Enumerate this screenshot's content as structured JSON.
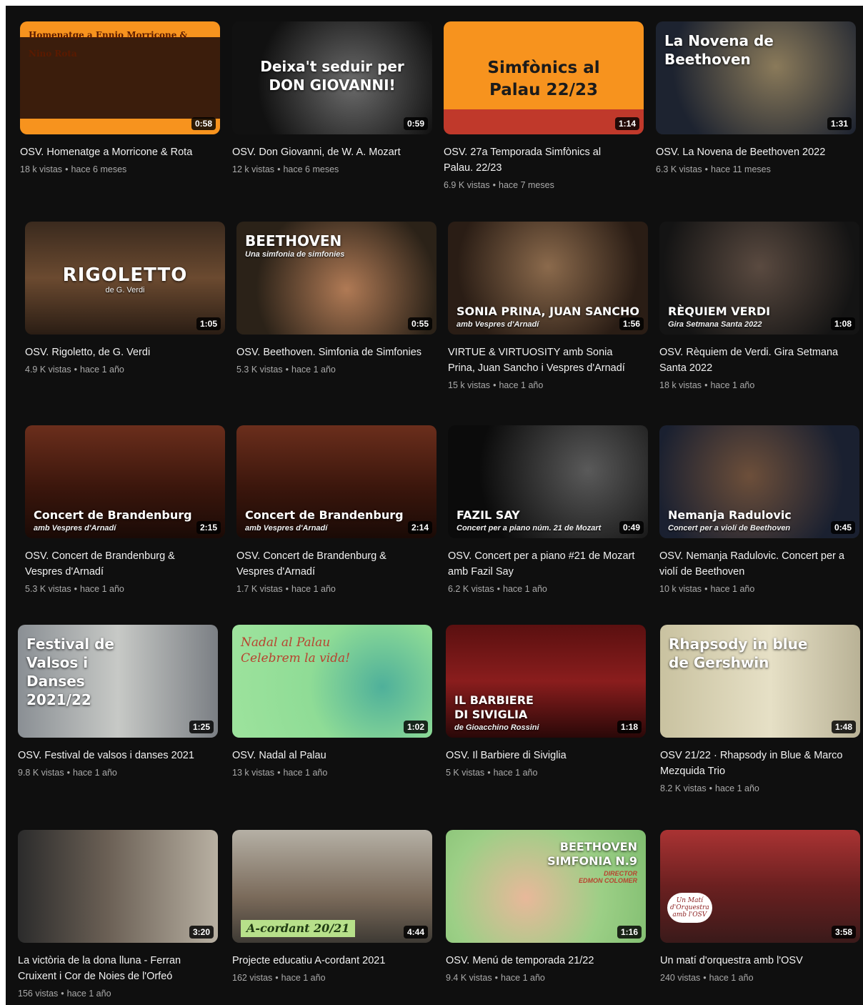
{
  "colors": {
    "background": "#0f0f0f",
    "title": "#f1f1f1",
    "meta": "#aaaaaa"
  },
  "rows": [
    [
      {
        "title": "OSV. Homenatge a Morricone & Rota",
        "views": "18 k vistas",
        "age": "hace 6 meses",
        "duration": "0:58",
        "thumb_text": "Homenatge a Ennio Morricone & Nino Rota",
        "thumb_bg": "linear-gradient(180deg,#f7931e 0 14%,#3b1d0c 14% 86%,#f7931e 86%)"
      },
      {
        "title": "OSV. Don Giovanni, de W. A. Mozart",
        "views": "12 k vistas",
        "age": "hace 6 meses",
        "duration": "0:59",
        "thumb_text": "Deixa't seduir per\nDON GIOVANNI!",
        "thumb_bg": "radial-gradient(circle at 60% 55%,#6b6b6b,#111 70%)"
      },
      {
        "title": "OSV. 27a Temporada Simfònics al Palau. 22/23",
        "views": "6.9 K vistas",
        "age": "hace 7 meses",
        "duration": "1:14",
        "thumb_text": "Simfònics al\nPalau 22/23",
        "thumb_bg": "linear-gradient(180deg,#f7931e 0 78%,#c0392b 78%)"
      },
      {
        "title": "OSV. La Novena de Beethoven 2022",
        "views": "6.3 K vistas",
        "age": "hace 11 meses",
        "duration": "1:31",
        "thumb_text": "La Novena de\nBeethoven",
        "thumb_bg": "radial-gradient(circle at 60% 40%,#8a7a5a,#1d2330 75%)"
      }
    ],
    [
      {
        "title": "OSV. Rigoletto, de G. Verdi",
        "views": "4.9 K vistas",
        "age": "hace 1 año",
        "duration": "1:05",
        "thumb_text": "RIGOLETTO",
        "thumb_sub": "de G. Verdi",
        "thumb_bg": "linear-gradient(180deg,#3a2a1e,#6b4a30 50%,#2a1d14)"
      },
      {
        "title": "OSV. Beethoven. Simfonia de Simfonies",
        "views": "5.3 K vistas",
        "age": "hace 1 año",
        "duration": "0:55",
        "thumb_text": "BEETHOVEN",
        "thumb_sub": "Una simfonia de simfonies",
        "thumb_bg": "radial-gradient(circle at 55% 60%,#b07a55,#2b2218 70%)"
      },
      {
        "title": "VIRTUE & VIRTUOSITY amb Sonia Prina, Juan Sancho i Vespres d'Arnadí",
        "views": "15 k vistas",
        "age": "hace 1 año",
        "duration": "1:56",
        "thumb_text": "SONIA PRINA, JUAN SANCHO",
        "thumb_sub": "amb Vespres d'Arnadí",
        "thumb_bg": "radial-gradient(circle at 50% 40%,#8b6a4c,#2a1d15 75%)"
      },
      {
        "title": "OSV. Rèquiem de Verdi. Gira Setmana Santa 2022",
        "views": "18 k vistas",
        "age": "hace 1 año",
        "duration": "1:08",
        "thumb_text": "RÈQUIEM VERDI",
        "thumb_sub": "Gira Setmana Santa 2022",
        "thumb_bg": "radial-gradient(circle at 50% 40%,#5a4a40,#141414 80%)"
      }
    ],
    [
      {
        "title": "OSV. Concert de Brandenburg & Vespres d'Arnadí",
        "views": "5.3 K vistas",
        "age": "hace 1 año",
        "duration": "2:15",
        "thumb_text": "Concert de Brandenburg",
        "thumb_sub": "amb Vespres d'Arnadí",
        "thumb_bg": "linear-gradient(180deg,#6b2e1c,#3b160c 55%,#1a0a06)"
      },
      {
        "title": "OSV. Concert de Brandenburg & Vespres d'Arnadí",
        "views": "1.7 K vistas",
        "age": "hace 1 año",
        "duration": "2:14",
        "thumb_text": "Concert de Brandenburg",
        "thumb_sub": "amb Vespres d'Arnadí",
        "thumb_bg": "linear-gradient(180deg,#6b2e1c,#3b160c 55%,#1a0a06)"
      },
      {
        "title": "OSV. Concert per a piano #21 de Mozart amb Fazil Say",
        "views": "6.2 K vistas",
        "age": "hace 1 año",
        "duration": "0:49",
        "thumb_text": "FAZIL SAY",
        "thumb_sub": "Concert per a piano núm. 21 de Mozart",
        "thumb_bg": "radial-gradient(circle at 70% 40%,#5a5a5a,#0b0b0b 70%)"
      },
      {
        "title": "OSV. Nemanja Radulovic. Concert per a violí de Beethoven",
        "views": "10 k vistas",
        "age": "hace 1 año",
        "duration": "0:45",
        "thumb_text": "Nemanja Radulovic",
        "thumb_sub": "Concert per a violí de Beethoven",
        "thumb_bg": "radial-gradient(circle at 45% 45%,#6d4f3a,#1a2030 75%)"
      }
    ],
    [
      {
        "title": "OSV. Festival de valsos i danses 2021",
        "views": "9.8 K vistas",
        "age": "hace 1 año",
        "duration": "1:25",
        "thumb_text": "Festival de\nValsos i\nDanses\n2021/22",
        "thumb_bg": "linear-gradient(90deg,#8a8f94,#c7c9c6 50%,#7b7f84)"
      },
      {
        "title": "OSV. Nadal al Palau",
        "views": "13 k vistas",
        "age": "hace 1 año",
        "duration": "1:02",
        "thumb_text": "Nadal al Palau\nCelebrem la vida!",
        "thumb_bg": "radial-gradient(circle at 75% 55%,#4fb09a,#8fdc96 45%,#9ee39d)"
      },
      {
        "title": "OSV. Il Barbiere di Siviglia",
        "views": "5 K vistas",
        "age": "hace 1 año",
        "duration": "1:18",
        "thumb_text": "IL BARBIERE\nDI SIVIGLIA",
        "thumb_sub": "de Gioacchino Rossini",
        "thumb_bg": "linear-gradient(180deg,#5a1010,#8a1d1d 50%,#2a0808)"
      },
      {
        "title": "OSV 21/22 · Rhapsody in Blue & Marco Mezquida Trio",
        "views": "8.2 K vistas",
        "age": "hace 1 año",
        "duration": "1:48",
        "thumb_text": "Rhapsody in blue\nde Gershwin",
        "thumb_bg": "linear-gradient(90deg,#c9c2a0,#e6e0c6 55%,#b9b296)"
      }
    ],
    [
      {
        "title": "La victòria de la dona lluna - Ferran Cruixent i Cor de Noies de l'Orfeó Català",
        "views": "156 vistas",
        "age": "hace 1 año",
        "duration": "3:20",
        "thumb_text": "",
        "thumb_bg": "linear-gradient(90deg,#2b2b2b,#6b6055 45%,#b8b0a2)"
      },
      {
        "title": "Projecte educatiu A-cordant 2021",
        "views": "162 vistas",
        "age": "hace 1 año",
        "duration": "4:44",
        "thumb_text": "A-cordant 20/21",
        "thumb_bg": "linear-gradient(180deg,#b5b0a5,#7a6a5a 60%,#3e3a34)"
      },
      {
        "title": "OSV. Menú de temporada 21/22",
        "views": "9.4 K vistas",
        "age": "hace 1 año",
        "duration": "1:16",
        "thumb_text": "BEETHOVEN\nSIMFONIA N.9",
        "thumb_sub": "DIRECTOR\nEDMON COLOMER",
        "thumb_bg": "radial-gradient(circle at 40% 60%,#e8b89a,#9ccf86 55%,#7fbd6f)"
      },
      {
        "title": "Un matí d'orquestra amb l'OSV",
        "views": "240 vistas",
        "age": "hace 1 año",
        "duration": "3:58",
        "thumb_text": "",
        "thumb_sub": "Un Matí\nd'Orquestra\namb l'OSV",
        "thumb_bg": "linear-gradient(180deg,#a33,#6b2020 50%,#3a1a1a)"
      }
    ]
  ]
}
